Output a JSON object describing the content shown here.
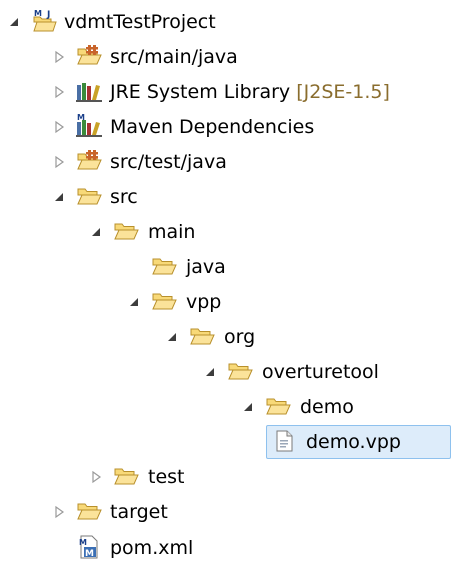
{
  "tree": {
    "project": {
      "label": "vdmtTestProject",
      "expanded": true,
      "icon": "vdm-maven-project-icon"
    },
    "items": [
      {
        "label": "src/main/java",
        "icon": "package-folder-icon",
        "expanded": false
      },
      {
        "label": "JRE System Library",
        "decoration": "[J2SE-1.5]",
        "icon": "library-icon",
        "expanded": false
      },
      {
        "label": "Maven Dependencies",
        "icon": "maven-library-icon",
        "expanded": false
      },
      {
        "label": "src/test/java",
        "icon": "package-folder-icon",
        "expanded": false
      },
      {
        "label": "src",
        "icon": "folder-open-icon",
        "expanded": true
      },
      {
        "label": "main",
        "icon": "folder-open-icon",
        "expanded": true
      },
      {
        "label": "java",
        "icon": "folder-open-icon"
      },
      {
        "label": "vpp",
        "icon": "folder-open-icon",
        "expanded": true
      },
      {
        "label": "org",
        "icon": "folder-open-icon",
        "expanded": true
      },
      {
        "label": "overturetool",
        "icon": "folder-open-icon",
        "expanded": true
      },
      {
        "label": "demo",
        "icon": "folder-open-icon",
        "expanded": true
      },
      {
        "label": "demo.vpp",
        "icon": "file-icon",
        "selected": true
      },
      {
        "label": "test",
        "icon": "folder-open-icon",
        "expanded": false
      },
      {
        "label": "target",
        "icon": "folder-open-icon",
        "expanded": false
      },
      {
        "label": "pom.xml",
        "icon": "maven-pom-icon"
      }
    ]
  },
  "colors": {
    "selection_bg": "#ddecfa",
    "selection_border": "#8ec1ee",
    "decoration_text": "#8a6d2e",
    "folder_fill": "#fbe39a",
    "folder_stroke": "#b8902c"
  }
}
